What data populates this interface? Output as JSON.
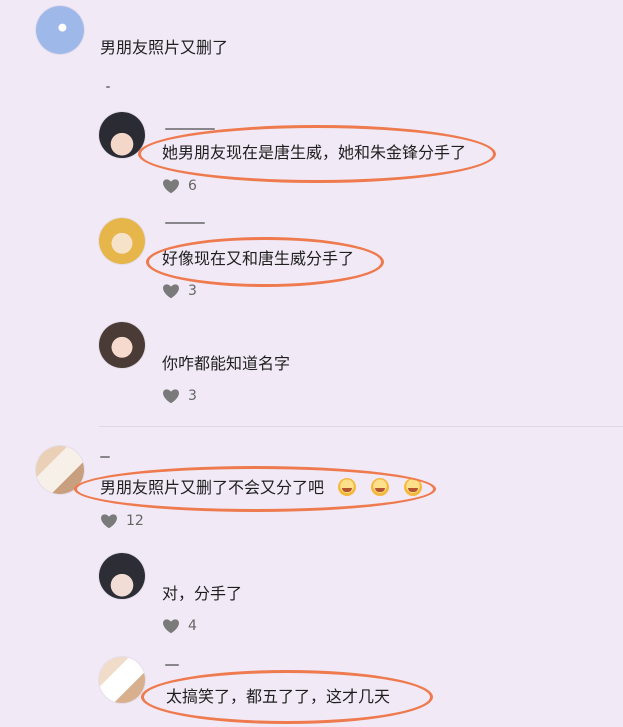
{
  "post": {
    "text": "男朋友照片又删了"
  },
  "replies": [
    {
      "text": "她男朋友现在是唐生威，她和朱金锋分手了",
      "likes": "6"
    },
    {
      "text": "好像现在又和唐生威分手了",
      "likes": "3"
    },
    {
      "text": "你咋都能知道名字",
      "likes": "3"
    }
  ],
  "comment2": {
    "text": "男朋友照片又删了不会又分了吧",
    "likes": "12",
    "emojis": [
      "laughing-crying-emoji",
      "laughing-crying-emoji",
      "laughing-crying-emoji"
    ]
  },
  "replies2": [
    {
      "text": "对，分手了",
      "likes": "4"
    },
    {
      "text": "太搞笑了，都五了了，这才几天"
    }
  ],
  "colors": {
    "background": "#f1e9f6",
    "highlight_oval": "#ee7a4e",
    "heart": "#7a7a7a"
  },
  "icons": {
    "like": "heart-icon"
  }
}
